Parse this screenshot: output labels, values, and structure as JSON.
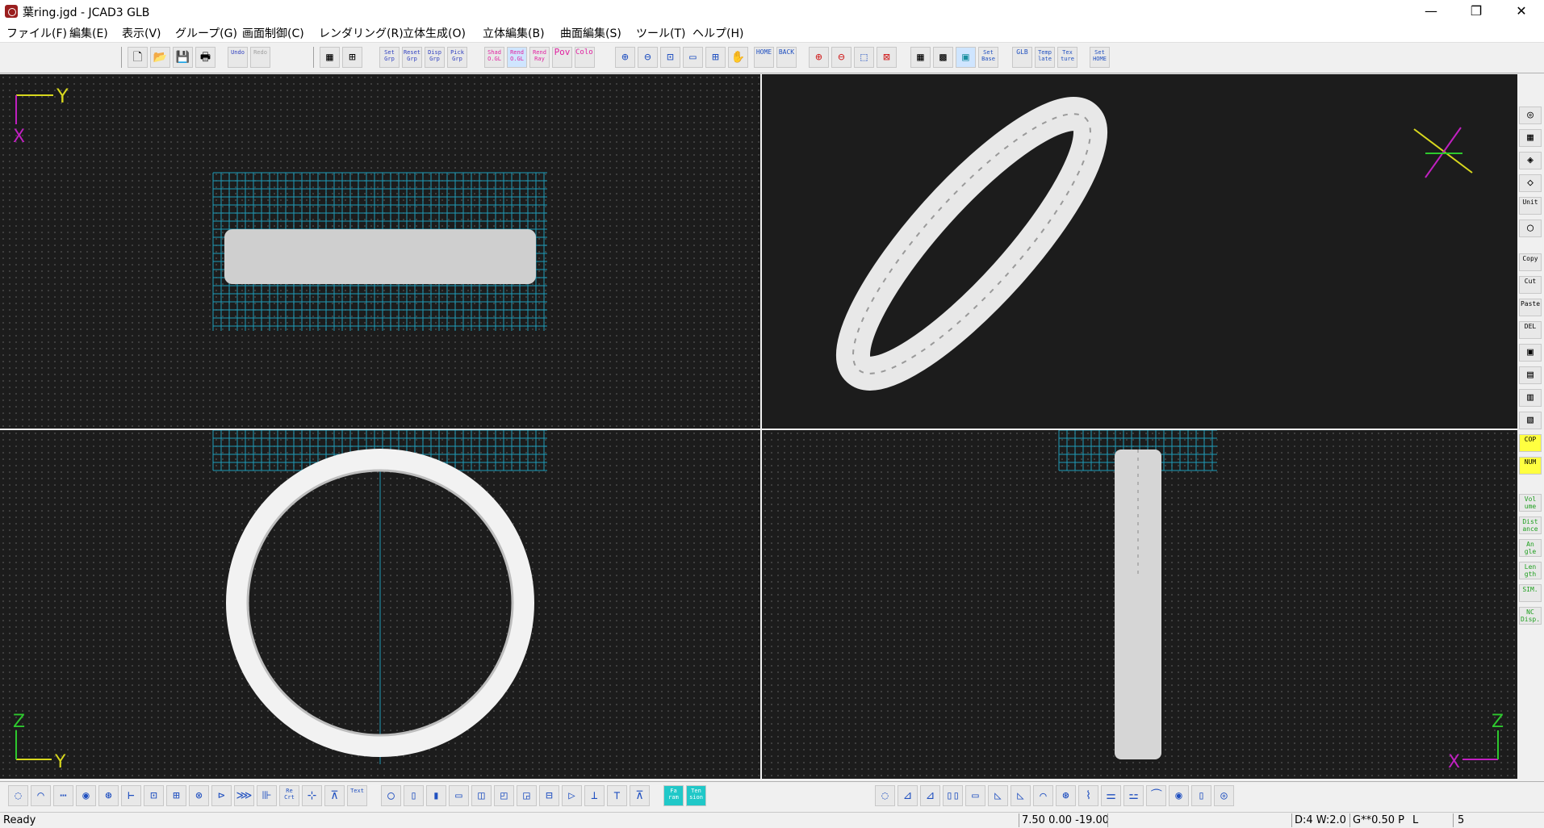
{
  "window": {
    "title": "葉ring.jgd - JCAD3 GLB"
  },
  "window_controls": {
    "minimize": "—",
    "restore": "❐",
    "close": "✕"
  },
  "menu": [
    "ファイル(F)",
    "編集(E)",
    "表示(V)",
    "グループ(G)",
    "画面制御(C)",
    "レンダリング(R)",
    "立体生成(O)",
    "立体編集(B)",
    "曲面編集(S)",
    "ツール(T)",
    "ヘルプ(H)"
  ],
  "toolbar": {
    "icons": {
      "new": "🗋",
      "open": "📂",
      "save": "💾",
      "print": "🖶"
    },
    "undo": "Undo",
    "redo": "Redo",
    "grp": [
      "Set Grp",
      "Reset Grp",
      "Disp Grp",
      "Pick Grp"
    ],
    "render": [
      "Shad O.GL",
      "Rend O.GL",
      "Rend Ray",
      "Pov",
      "Color"
    ],
    "view_icons": {
      "zoom_in": "⊕",
      "zoom_out": "⊖",
      "zoom_window": "⊡",
      "ruler": "▭",
      "fit": "⊞",
      "pan": "✋"
    },
    "home": "HOME",
    "back": "BACK",
    "zoom2": [
      "⊕",
      "⊖",
      "⬚",
      "⊠"
    ],
    "grid": [
      "▦",
      "▩",
      "▣"
    ],
    "set_base": "Set Base",
    "glb": "GLB",
    "template": "Temp late",
    "texture": "Tex ture",
    "set_home": "Set HOME"
  },
  "views": {
    "top": {
      "axis_v": "X",
      "axis_h": "Y"
    },
    "front": {
      "axis_v": "Z",
      "axis_h": "Y"
    },
    "side": {
      "axis_v": "Z",
      "axis_h": "X"
    }
  },
  "colors": {
    "axis_yellow": "#d8d81e",
    "axis_magenta": "#c020c0",
    "axis_green": "#2ec82e",
    "grid_cyan": "#1e9bb8",
    "background": "#1c1c1c"
  },
  "right_tools": [
    "◎",
    "▦",
    "◈",
    "◇",
    "Unit",
    "◯",
    "Copy",
    "Cut",
    "Paste",
    "DEL",
    "▣",
    "▤",
    "▥",
    "▧",
    "COP",
    "NUM",
    "Vol ume",
    "Dist ance",
    "An gle",
    "Len gth",
    "SIM.",
    "NC Disp."
  ],
  "bottom_tools_left": [
    "◌",
    "◠",
    "⋯",
    "◉",
    "⊛",
    "⊢",
    "⊡",
    "⊞",
    "⊗",
    "⊳",
    "⋙",
    "⊪",
    "Re Crt",
    "⊹",
    "⊼",
    "Text",
    "◯",
    "▯",
    "▮",
    "▭",
    "◫",
    "◰",
    "◲",
    "⊟",
    "▷",
    "⊥",
    "⊤",
    "⊼",
    "Fa ram",
    "Ten sion"
  ],
  "bottom_tools_right": [
    "◌",
    "⊿",
    "⊿",
    "▯▯",
    "▭",
    "◺",
    "◺",
    "⌒",
    "⊛",
    "⌇",
    "⚌",
    "⚍",
    "⏜",
    "◉",
    "▯",
    "◎"
  ],
  "status": {
    "ready": "Ready",
    "coords": "7.50 0.00 -19.00",
    "blank": "",
    "display": "D:4 W:2.0",
    "grid": "G**0.50 P",
    "mode": "L",
    "count": "5"
  }
}
